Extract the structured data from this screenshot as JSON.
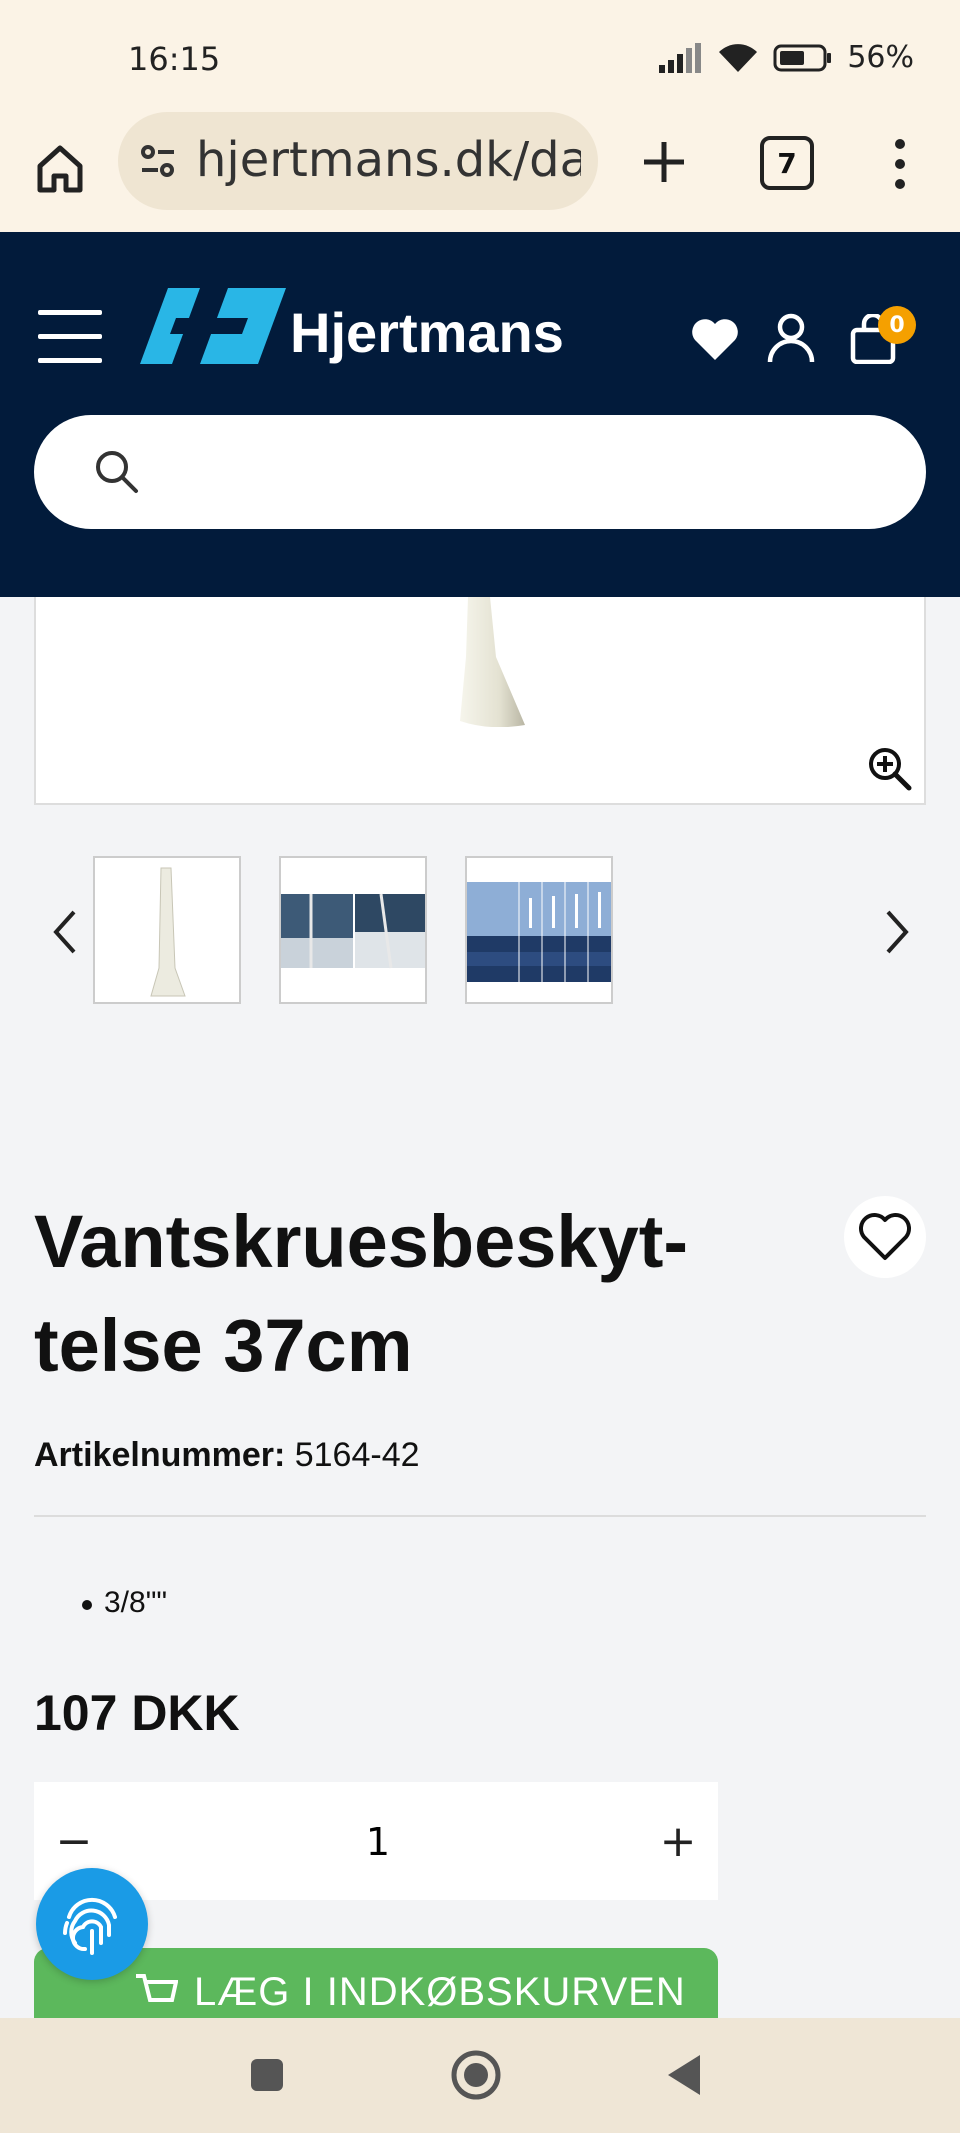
{
  "status_bar": {
    "time": "16:15",
    "battery": "56%"
  },
  "browser": {
    "url": "hjertmans.dk/da",
    "tab_count": "7"
  },
  "site": {
    "brand": "Hjertmans",
    "cart_count": "0",
    "search_placeholder": ""
  },
  "product": {
    "title": "Vantskruesbeskyt-telse 37cm",
    "sku_label": "Artikelnummer:",
    "sku_value": "5164-42",
    "features": [
      "3/8\"\""
    ],
    "price": "107 DKK",
    "quantity": "1",
    "add_to_cart": "LÆG I INDKØBSKURVEN"
  },
  "colors": {
    "header_bg": "#021b3b",
    "logo_accent": "#29b6e6",
    "cart_badge": "#f5a000",
    "add_to_cart_bg": "#5cb85c",
    "fingerprint_bg": "#1a9be6"
  }
}
